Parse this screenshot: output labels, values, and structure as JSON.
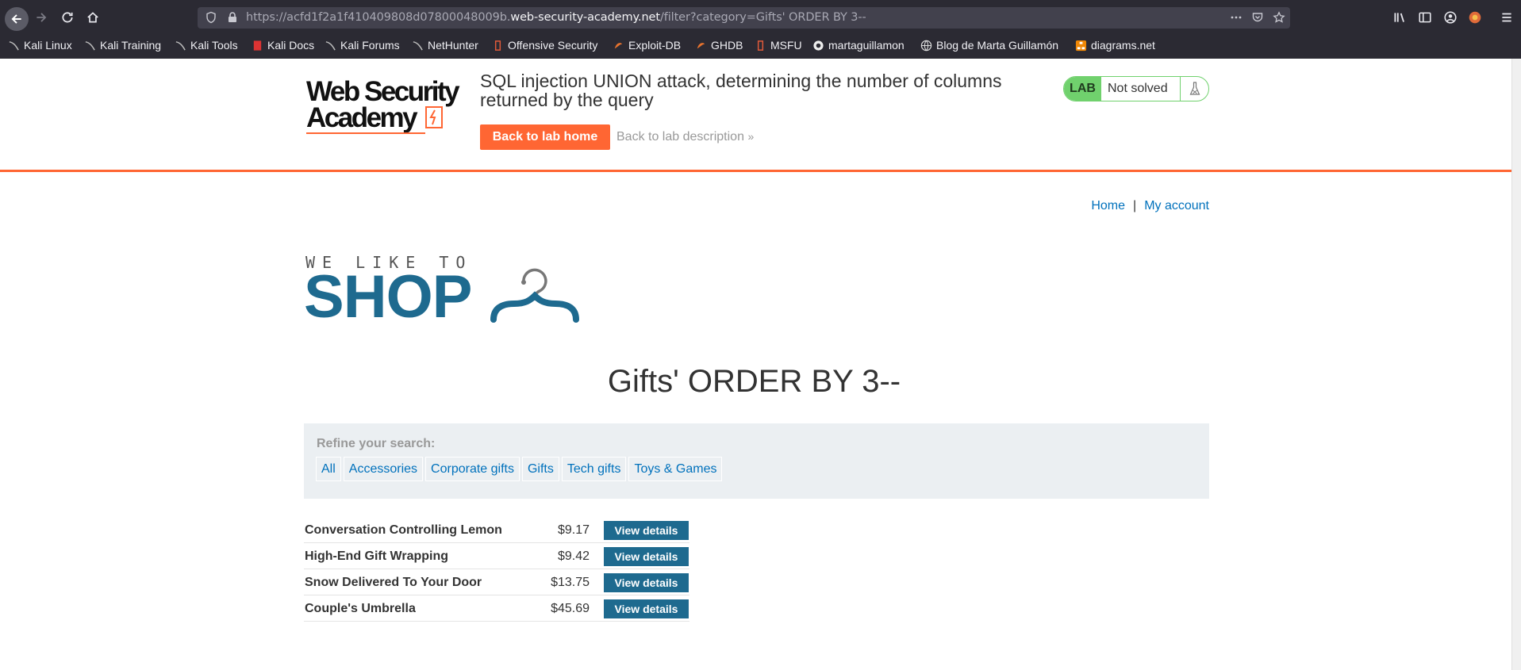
{
  "browser": {
    "url_prefix": "https://acfd1f2a1f410409808d07800048009b.",
    "url_host": "web-security-academy.net",
    "url_path": "/filter?category=Gifts' ORDER BY 3--",
    "bookmarks": [
      "Kali Linux",
      "Kali Training",
      "Kali Tools",
      "Kali Docs",
      "Kali Forums",
      "NetHunter",
      "Offensive Security",
      "Exploit-DB",
      "GHDB",
      "MSFU",
      "martaguillamon",
      "Blog de Marta Guillamón",
      "diagrams.net"
    ]
  },
  "lab_header": {
    "logo_line1": "Web Security",
    "logo_line2": "Academy",
    "title": "SQL injection UNION attack, determining the number of columns returned by the query",
    "back_home": "Back to lab home",
    "back_description": "Back to lab description",
    "status_badge": "LAB",
    "status": "Not solved"
  },
  "nav": {
    "home": "Home",
    "separator": "|",
    "account": "My account"
  },
  "shop_logo": {
    "tagline": "WE LIKE TO",
    "word": "SHOP"
  },
  "heading": "Gifts' ORDER BY 3--",
  "refine": {
    "label": "Refine your search:",
    "categories": [
      "All",
      "Accessories",
      "Corporate gifts",
      "Gifts",
      "Tech gifts",
      "Toys & Games"
    ]
  },
  "products": [
    {
      "name": "Conversation Controlling Lemon",
      "price": "$9.17",
      "button": "View details"
    },
    {
      "name": "High-End Gift Wrapping",
      "price": "$9.42",
      "button": "View details"
    },
    {
      "name": "Snow Delivered To Your Door",
      "price": "$13.75",
      "button": "View details"
    },
    {
      "name": "Couple's Umbrella",
      "price": "$45.69",
      "button": "View details"
    }
  ],
  "colors": {
    "accent_orange": "#ff6633",
    "brand_blue": "#1e6a8f",
    "link_blue": "#0071bc",
    "lab_green": "#70d16d"
  }
}
